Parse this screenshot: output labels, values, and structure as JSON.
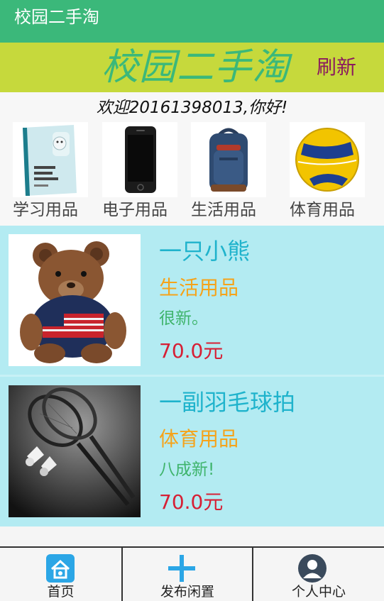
{
  "appbar": {
    "title": "校园二手淘"
  },
  "banner": {
    "title": "校园二手淘",
    "refresh_label": "刷新"
  },
  "welcome": {
    "text": "欢迎20161398013,你好!"
  },
  "categories": [
    {
      "label": "学习用品",
      "icon": "book-icon"
    },
    {
      "label": "电子用品",
      "icon": "phone-icon"
    },
    {
      "label": "生活用品",
      "icon": "backpack-icon"
    },
    {
      "label": "体育用品",
      "icon": "volleyball-icon"
    }
  ],
  "items": [
    {
      "name": "一只小熊",
      "category": "生活用品",
      "description": "很新。",
      "price": "70.0元",
      "image": "teddy-bear-image"
    },
    {
      "name": "一副羽毛球拍",
      "category": "体育用品",
      "description": "八成新!",
      "price": "70.0元",
      "image": "badminton-racket-image"
    }
  ],
  "nav": [
    {
      "label": "首页",
      "icon": "home-icon"
    },
    {
      "label": "发布闲置",
      "icon": "plus-icon"
    },
    {
      "label": "个人中心",
      "icon": "user-icon"
    }
  ],
  "colors": {
    "appbar": "#3bb87a",
    "banner": "#c6d93c",
    "list_bg": "#b3ebf2",
    "item_name": "#1fb3cc",
    "item_category": "#f5a31a",
    "item_desc": "#3fb46c",
    "item_price": "#d62035",
    "refresh": "#8b1a5e"
  }
}
